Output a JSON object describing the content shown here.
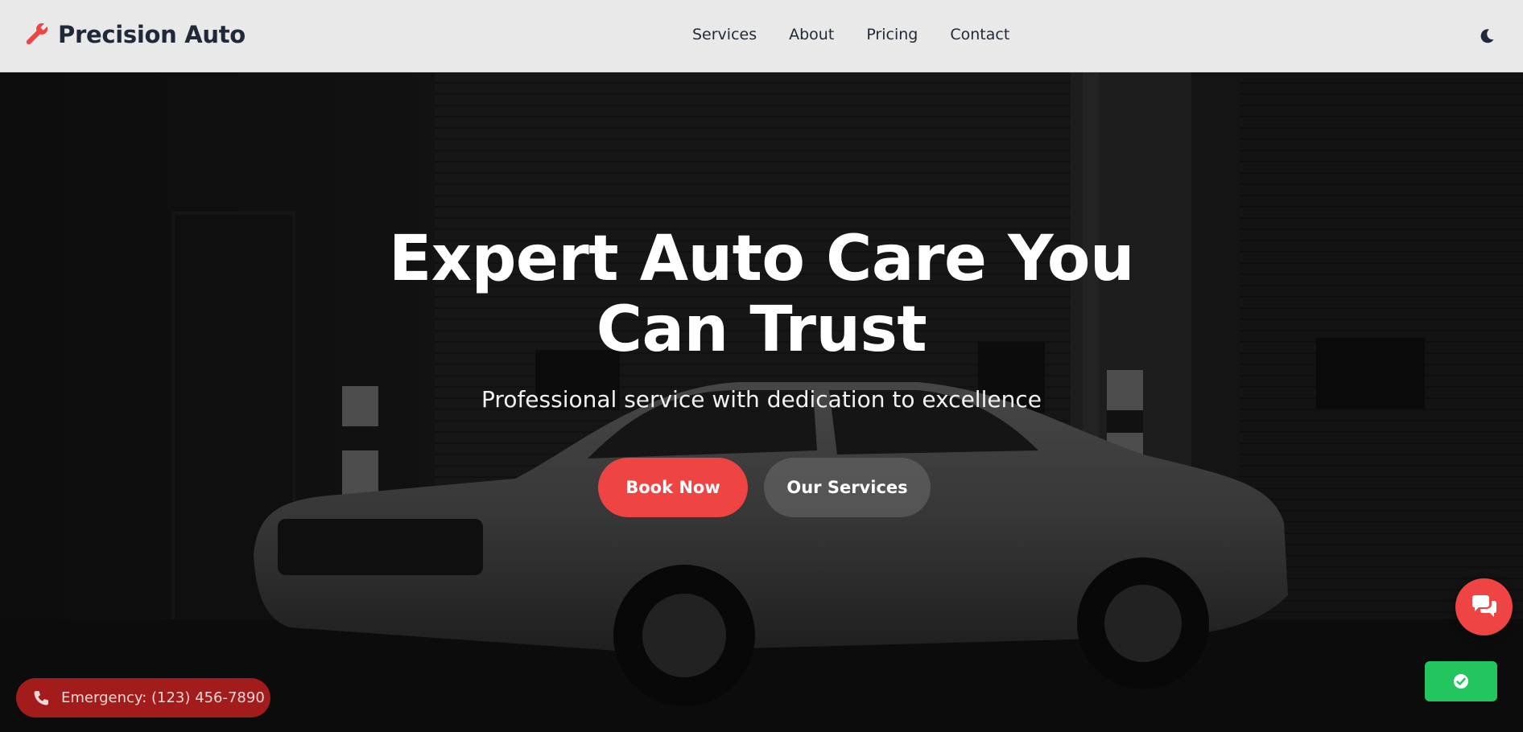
{
  "header": {
    "brand": "Precision Auto",
    "nav": [
      "Services",
      "About",
      "Pricing",
      "Contact"
    ]
  },
  "hero": {
    "title": "Expert Auto Care You Can Trust",
    "subtitle": "Professional service with dedication to excellence",
    "primary_button": "Book Now",
    "secondary_button": "Our Services"
  },
  "emergency": {
    "label": "Emergency: (123) 456-7890"
  },
  "icons": {
    "brand": "wrench-icon",
    "theme_toggle": "moon-icon",
    "emergency": "phone-icon",
    "chat": "chat-bubbles-icon",
    "status": "check-circle-icon"
  },
  "colors": {
    "accent": "#ef4444",
    "emergency_bg": "#a31c1c",
    "status": "#22c55e",
    "header_bg": "#e9e9e9",
    "text_dark": "#1f2937"
  }
}
